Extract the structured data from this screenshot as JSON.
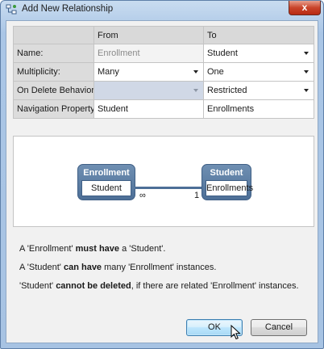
{
  "window": {
    "title": "Add New Relationship",
    "close_label": "x"
  },
  "grid": {
    "headers": {
      "from": "From",
      "to": "To"
    },
    "rows": [
      {
        "label": "Name:",
        "from": "Enrollment",
        "to": "Student"
      },
      {
        "label": "Multiplicity:",
        "from": "Many",
        "to": "One"
      },
      {
        "label": "On Delete Behavior:",
        "from": "",
        "to": "Restricted"
      },
      {
        "label": "Navigation Property:",
        "from": "Student",
        "to": "Enrollments"
      }
    ]
  },
  "diagram": {
    "left_entity": {
      "name": "Enrollment",
      "property": "Student"
    },
    "right_entity": {
      "name": "Student",
      "property": "Enrollments"
    },
    "left_multiplicity": "∞",
    "right_multiplicity": "1"
  },
  "messages": [
    {
      "pre": "A 'Enrollment' ",
      "bold": "must have",
      "post": " a 'Student'."
    },
    {
      "pre": "A 'Student' ",
      "bold": "can have",
      "post": " many 'Enrollment' instances."
    },
    {
      "pre": "'Student' ",
      "bold": "cannot be deleted",
      "post": ", if there are related 'Enrollment' instances."
    }
  ],
  "buttons": {
    "ok": "OK",
    "cancel": "Cancel"
  },
  "colors": {
    "entity_fill": "#5a7ca3",
    "title_gradient": "#aac6e6",
    "ok_highlight": "#bee6fd"
  }
}
